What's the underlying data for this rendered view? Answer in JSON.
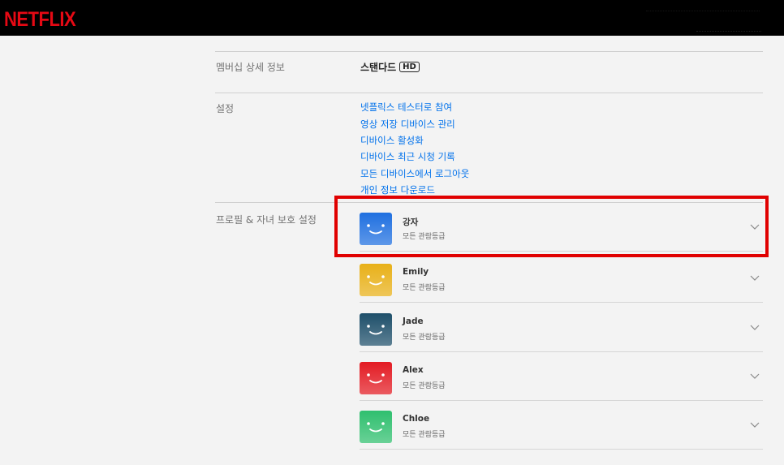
{
  "header": {
    "logo": "NETFLIX"
  },
  "membership": {
    "label": "멤버십 상세 정보",
    "plan": "스탠다드",
    "badge": "HD"
  },
  "settings": {
    "label": "설정",
    "links": [
      "넷플릭스 테스터로 참여",
      "영상 저장 디바이스 관리",
      "디바이스 활성화",
      "디바이스 최근 시청 기록",
      "모든 디바이스에서 로그아웃",
      "개인 정보 다운로드"
    ]
  },
  "profiles_section": {
    "label": "프로필 & 자녀 보호 설정",
    "profiles": [
      {
        "name": "강자",
        "rating": "모든 관람등급",
        "color": "#1f6fe0"
      },
      {
        "name": "Emily",
        "rating": "모든 관람등급",
        "color": "#e8b018"
      },
      {
        "name": "Jade",
        "rating": "모든 관람등급",
        "color": "#1e4f6a"
      },
      {
        "name": "Alex",
        "rating": "모든 관람등급",
        "color": "#e31b23"
      },
      {
        "name": "Chloe",
        "rating": "모든 관람등급",
        "color": "#2fbf6e"
      }
    ]
  },
  "colors": {
    "brand": "#e50914",
    "link": "#0071eb",
    "highlight": "#e00000"
  }
}
